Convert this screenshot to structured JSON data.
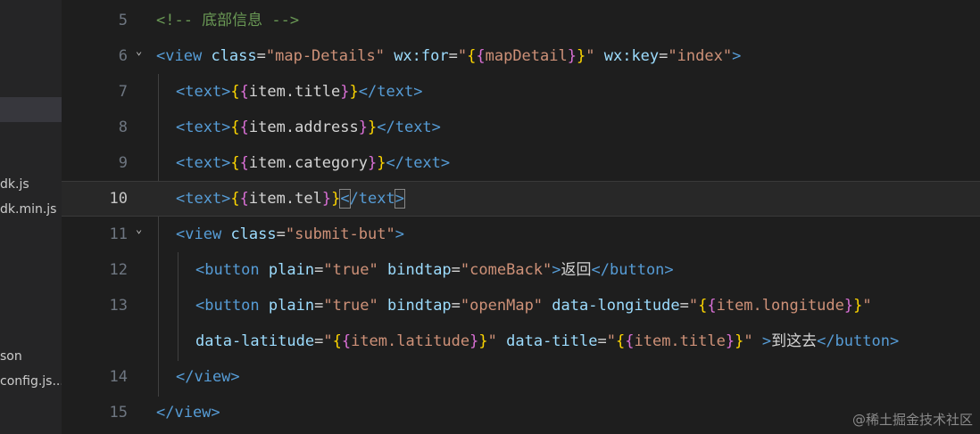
{
  "sidebar": {
    "files": [
      "dk.js",
      "dk.min.js",
      "son",
      "config.js..."
    ]
  },
  "editor": {
    "lines": [
      {
        "num": "5",
        "comment": "<!-- 底部信息 -->"
      },
      {
        "num": "6",
        "tag_open": "<view",
        "attr1": "class",
        "val1": "\"map-Details\"",
        "attr2": "wx:for",
        "val2_q1": "\"",
        "val2_inner": "mapDetail",
        "val2_q2": "\"",
        "attr3": "wx:key",
        "val3": "\"index\"",
        "tag_close": ">"
      },
      {
        "num": "7",
        "open": "<text>",
        "expr": "item.title",
        "close": "</text>"
      },
      {
        "num": "8",
        "open": "<text>",
        "expr": "item.address",
        "close": "</text>"
      },
      {
        "num": "9",
        "open": "<text>",
        "expr": "item.category",
        "close": "</text>"
      },
      {
        "num": "10",
        "open": "<text>",
        "expr": "item.tel",
        "close_a": "<",
        "close_b": "/text",
        "close_c": ">"
      },
      {
        "num": "11",
        "tag_open": "<view",
        "attr": "class",
        "val": "\"submit-but\"",
        "tag_close": ">"
      },
      {
        "num": "12",
        "tag_open": "<button",
        "attr1": "plain",
        "val1": "\"true\"",
        "attr2": "bindtap",
        "val2": "\"comeBack\"",
        "gt": ">",
        "text": "返回",
        "close": "</button>"
      },
      {
        "num": "13",
        "tag_open": "<button",
        "attr1": "plain",
        "val1": "\"true\"",
        "attr2": "bindtap",
        "val2": "\"openMap\"",
        "attr3": "data-longitude",
        "expr": "item.longitude"
      },
      {
        "num": "",
        "attr1": "data-latitude",
        "expr1": "item.latitude",
        "attr2": "data-title",
        "expr2": "item.title",
        "gt": " >",
        "text": "到这去",
        "close": "</button>"
      },
      {
        "num": "14",
        "close": "</view>"
      },
      {
        "num": "15",
        "close": "</view>"
      }
    ]
  },
  "watermark": "@稀土掘金技术社区"
}
